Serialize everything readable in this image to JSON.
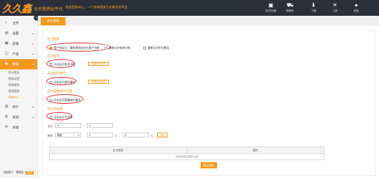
{
  "header": {
    "logo": "久久鑫",
    "subtitle": "全员营销云平台",
    "slogan": "快客营销中心，一个多种营销方式聚合的平台",
    "tools": [
      {
        "icon": "store-icon",
        "label": "同步店铺"
      },
      {
        "icon": "cart-icon",
        "label": "购物车"
      },
      {
        "icon": "download-icon",
        "label": "下载"
      },
      {
        "icon": "tools-icon",
        "label": "工具"
      },
      {
        "icon": "user-icon",
        "label": "老板"
      }
    ]
  },
  "sidebar": {
    "items": [
      {
        "icon": "home-icon",
        "label": "主页",
        "arrow": ""
      },
      {
        "icon": "settings-icon",
        "label": "设置",
        "arrow": "▸"
      },
      {
        "icon": "store-icon",
        "label": "店铺",
        "arrow": "▸"
      },
      {
        "icon": "product-icon",
        "label": "产品",
        "arrow": "▸"
      },
      {
        "icon": "marketing-icon",
        "label": "营销",
        "arrow": "▾"
      }
    ],
    "subitems": [
      "积分营销",
      "营销设置",
      "营销规则",
      "营销管理",
      "营销中心"
    ],
    "items2": [
      {
        "icon": "stats-icon",
        "label": "统计",
        "arrow": "▸"
      },
      {
        "icon": "system-icon",
        "label": "系统",
        "arrow": "▸"
      },
      {
        "icon": "message-icon",
        "label": "商城",
        "arrow": ""
      }
    ],
    "footer_text": "当前用户：营销员",
    "footer_button": "退出"
  },
  "tab": {
    "label": "支付营销"
  },
  "sections": {
    "s1": {
      "title": "支付规则",
      "opt1": "客户到店后，重新营销状态为客户付款",
      "opt2": "重新允许修改付款",
      "opt3": "重新允许积分使用"
    },
    "s2": {
      "title": "支付规则",
      "opt": "开启支付修改功能",
      "btn": "设置修改规则"
    },
    "s3": {
      "title": "支付超时事件",
      "opt": "开启支付超时事件",
      "btn": "设置超时规则"
    },
    "s4": {
      "title": "支付提醒超时设置",
      "opt": "开启支付提醒超时事件"
    },
    "s5": {
      "title": "支付手续费",
      "opt": "开启支付手续费",
      "row1_label": "支付",
      "row1_val1": "0",
      "row1_sep": "~",
      "row1_val2": "0",
      "row2_label": "费率",
      "row2_select": "随机",
      "row2_val1": "0",
      "row2_unit1": "元",
      "row2_sep": "~",
      "row2_val2": "0",
      "row2_unit2": "元",
      "add_btn": "添加"
    }
  },
  "table": {
    "columns": [
      "支付规则",
      "操作"
    ],
    "empty": "没有找到匹配的记录"
  },
  "save_button": "确认保存"
}
